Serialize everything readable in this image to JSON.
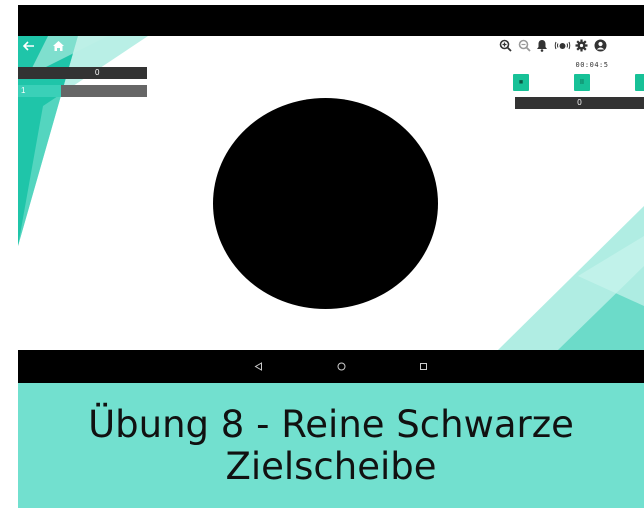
{
  "top_toolbar": {
    "back_icon": "arrow-left-icon",
    "home_icon": "home-icon",
    "right_icons": [
      "zoom-in-icon",
      "zoom-out-icon",
      "bell-icon",
      "vibration-icon",
      "gear-icon",
      "user-icon"
    ]
  },
  "left_panel": {
    "bar_label": "0",
    "progress_value": "1",
    "progress_fraction": 0.33
  },
  "right_panel": {
    "timer": "00:04:5",
    "buttons": [
      {
        "icon": "stop-icon",
        "label": "■"
      },
      {
        "icon": "pause-icon",
        "label": "II"
      },
      {
        "icon": "next-icon",
        "label": ""
      }
    ],
    "bar_label": "0"
  },
  "target": {
    "color": "#000000"
  },
  "android_nav": {
    "back_icon": "triangle-back-icon",
    "home_icon": "circle-home-icon",
    "recents_icon": "square-recents-icon"
  },
  "caption": {
    "text": "Übung 8 - Reine Schwarze\nZielscheibe",
    "background": "#72e0cf"
  },
  "colors": {
    "teal": "#3ad0b8",
    "green_button": "#17c197",
    "dark_bar": "#333333"
  }
}
